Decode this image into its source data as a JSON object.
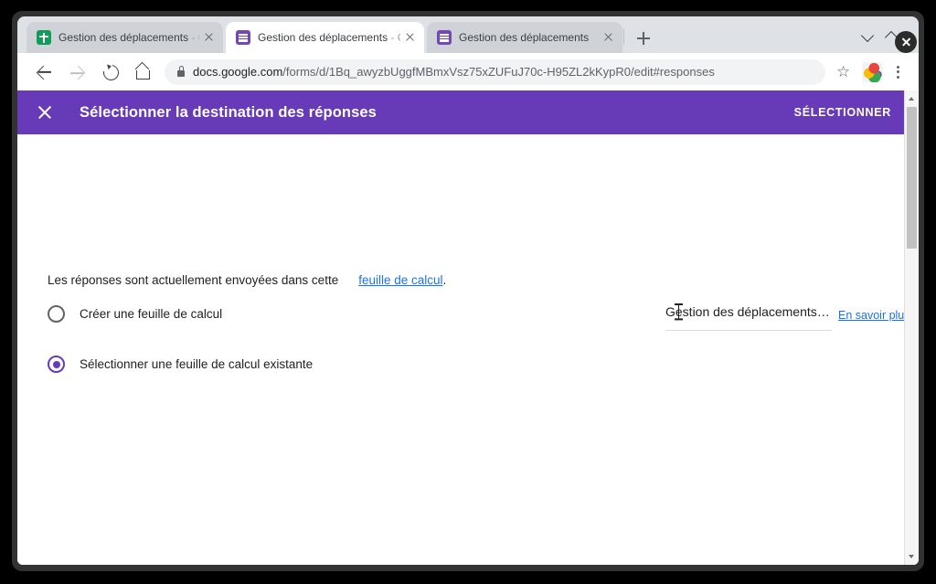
{
  "window": {
    "controls": {
      "minimize": "minimize-window",
      "maximize": "maximize-window",
      "close": "close-window"
    }
  },
  "tabs": [
    {
      "title": "Gestion des déplacements",
      "suffix": " - G",
      "favicon": "google-sheets-icon",
      "active": false
    },
    {
      "title": "Gestion des déplacements",
      "suffix": " - G",
      "favicon": "google-forms-icon",
      "active": true
    },
    {
      "title": "Gestion des déplacements",
      "suffix": "",
      "favicon": "google-forms-icon",
      "active": false
    }
  ],
  "newtab_label": "+",
  "toolbar": {
    "back": "back-button",
    "forward": "forward-button",
    "reload": "reload-button",
    "home": "home-button",
    "url_host": "docs.google.com",
    "url_path": "/forms/d/1Bq_awyzbUggfMBmxVsz75xZUFuJ70c-H95ZL2kKypR0/edit#responses",
    "bookmark_glyph": "☆",
    "avatar": "profile-avatar",
    "menu": "browser-menu"
  },
  "dialog": {
    "title": "Sélectionner la destination des réponses",
    "action_label": "SÉLECTIONNER",
    "close_label": "Fermer",
    "accent_color": "#673ab7",
    "intro_text": "Les réponses sont actuellement envoyées dans cette",
    "intro_link": "feuille de calcul",
    "intro_suffix": ".",
    "options": [
      {
        "label": "Créer une feuille de calcul",
        "selected": false
      },
      {
        "label": "Sélectionner une feuille de calcul existante",
        "selected": true
      }
    ],
    "sheet_field_value": "Gestion des déplacements…",
    "learn_more_label": "En savoir plus",
    "link_color": "#1a73e8"
  }
}
